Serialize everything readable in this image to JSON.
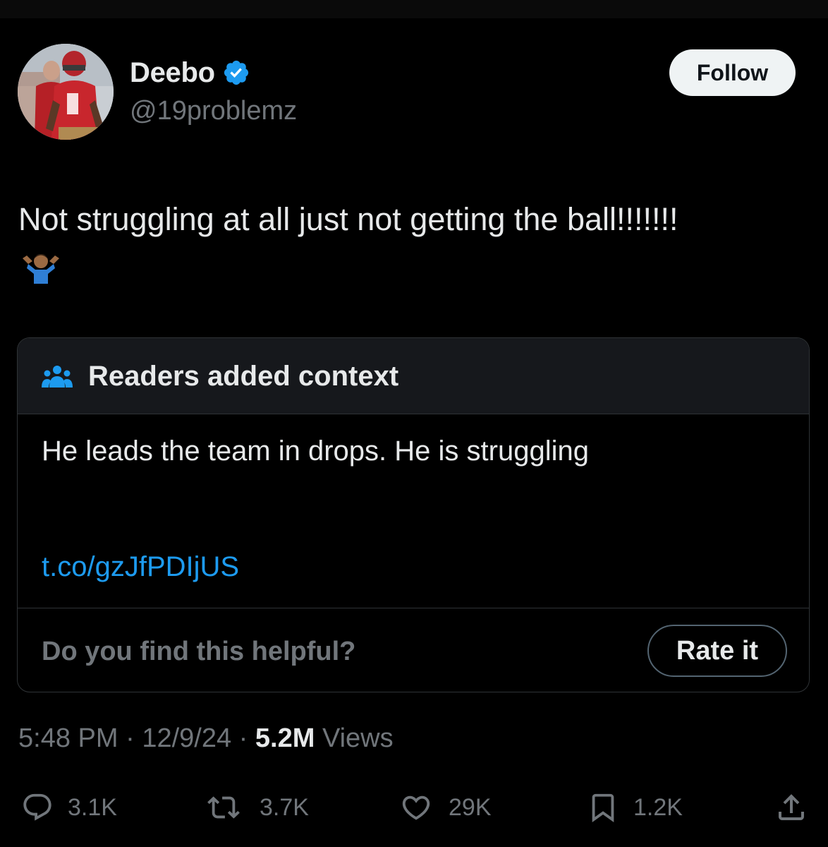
{
  "author": {
    "display_name": "Deebo",
    "handle": "@19problemz",
    "verified_icon": "verified-badge-icon",
    "verified_color": "#1d9bf0"
  },
  "follow_label": "Follow",
  "tweet": {
    "text": "Not struggling at all just not getting the ball!!!!!!!",
    "emoji": "shrug-emoji"
  },
  "community_note": {
    "title": "Readers added context",
    "icon": "readers-icon",
    "body": "He leads the team in drops. He is struggling",
    "link": "t.co/gzJfPDIjUS",
    "helpful_question": "Do you find this helpful?",
    "rate_label": "Rate it"
  },
  "meta": {
    "time": "5:48 PM",
    "date": "12/9/24",
    "separator": "·",
    "views_count": "5.2M",
    "views_label": "Views"
  },
  "actions": {
    "replies": "3.1K",
    "reposts": "3.7K",
    "likes": "29K",
    "bookmarks": "1.2K"
  },
  "colors": {
    "background": "#000000",
    "text": "#e7e9ea",
    "muted": "#71767b",
    "link": "#1d9bf0",
    "border": "#2f3336"
  }
}
